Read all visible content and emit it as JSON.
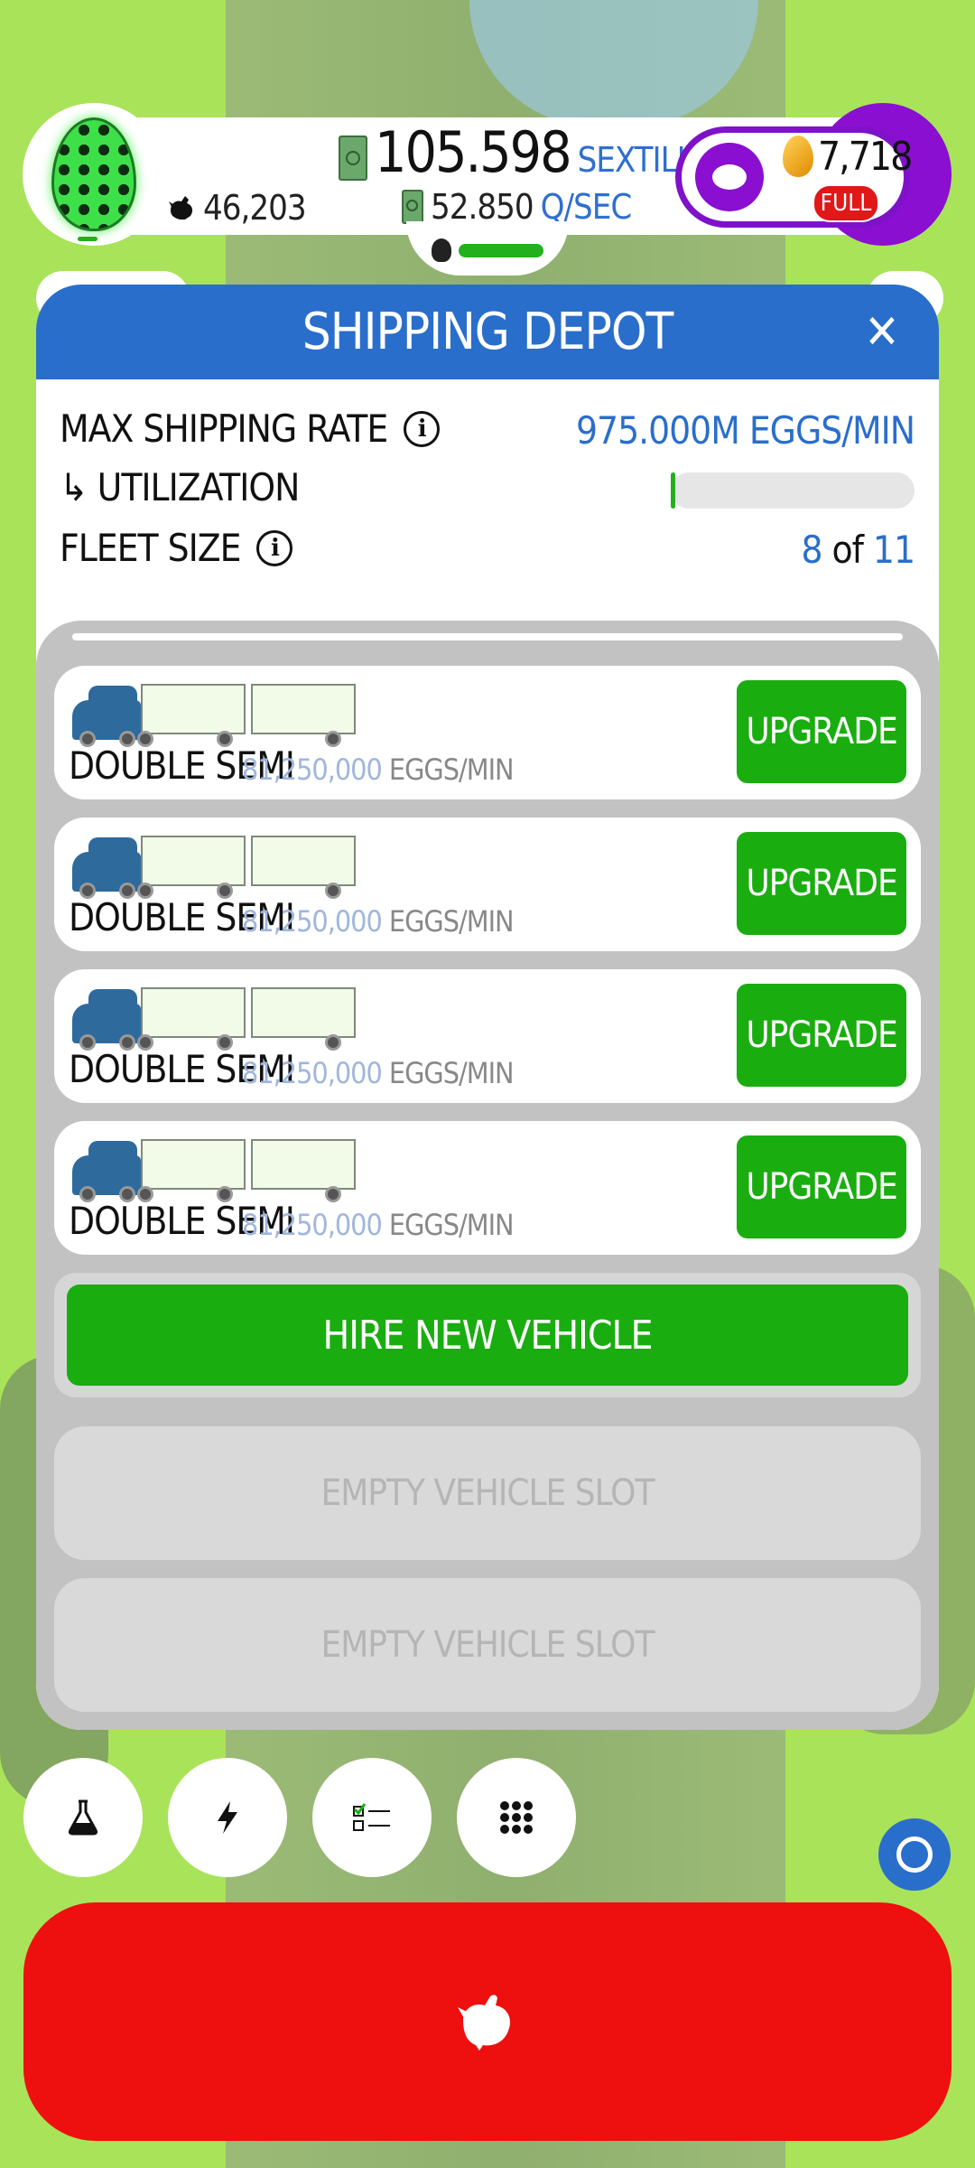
{
  "hud": {
    "chicken_count": "46,203",
    "money_value": "105.598",
    "money_unit": "SEXTILLION",
    "rate_value": "52.850",
    "rate_unit": "Q/SEC",
    "golden_eggs": "7,718",
    "piggy_status": "FULL"
  },
  "panel": {
    "title": "SHIPPING DEPOT",
    "close_label": "✕",
    "max_rate_label": "MAX SHIPPING RATE",
    "max_rate_value": "975.000M EGGS/MIN",
    "utilization_label": "↳ UTILIZATION",
    "utilization_fraction": 0.015,
    "fleet_size_label": "FLEET SIZE",
    "fleet_current": "8",
    "fleet_of": "of",
    "fleet_max": "11"
  },
  "vehicles": [
    {
      "name": "DOUBLE SEMI",
      "rate": "81,250,000",
      "unit": "EGGS/MIN",
      "button": "UPGRADE"
    },
    {
      "name": "DOUBLE SEMI",
      "rate": "81,250,000",
      "unit": "EGGS/MIN",
      "button": "UPGRADE"
    },
    {
      "name": "DOUBLE SEMI",
      "rate": "81,250,000",
      "unit": "EGGS/MIN",
      "button": "UPGRADE"
    },
    {
      "name": "DOUBLE SEMI",
      "rate": "81,250,000",
      "unit": "EGGS/MIN",
      "button": "UPGRADE"
    }
  ],
  "hire_button": "HIRE NEW VEHICLE",
  "empty_slots": [
    "EMPTY VEHICLE SLOT",
    "EMPTY VEHICLE SLOT"
  ],
  "nav": {
    "icons": [
      "flask-icon",
      "lightning-icon",
      "checklist-icon",
      "grid-icon"
    ]
  },
  "colors": {
    "header_blue": "#2a6ecb",
    "upgrade_green": "#1aad10",
    "hatch_red": "#ee0f0f",
    "gold_purple": "#8a0fd0"
  }
}
